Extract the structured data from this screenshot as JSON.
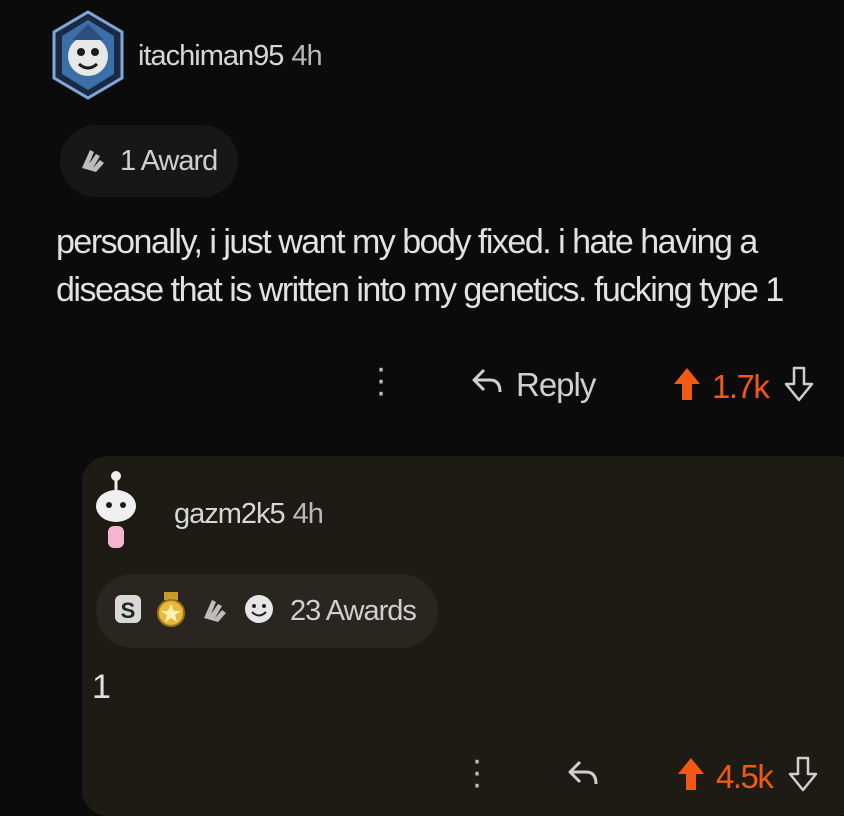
{
  "comment": {
    "username": "itachiman95",
    "time": "4h",
    "award_label": "1 Award",
    "body_line1": "personally, i just want my body fixed. i hate having a",
    "body_line2": "disease that is written into my genetics. fucking type 1",
    "reply_label": "Reply",
    "score": "1.7k",
    "icons": {
      "avatar": "avatar-icon",
      "award": "hands-award-icon",
      "menu": "more-options-icon",
      "reply": "reply-arrow-icon",
      "upvote": "upvote-arrow-icon",
      "downvote": "downvote-arrow-icon"
    }
  },
  "reply": {
    "username": "gazm2k5",
    "time": "4h",
    "award_label": "23 Awards",
    "body": "1",
    "score": "4.5k",
    "icons": {
      "avatar": "snoo-avatar-icon",
      "awards": [
        "silver-award-icon",
        "gold-award-icon",
        "hands-award-icon",
        "wholesome-award-icon"
      ],
      "menu": "more-options-icon",
      "reply": "reply-arrow-icon",
      "upvote": "upvote-arrow-icon",
      "downvote": "downvote-arrow-icon"
    }
  },
  "colors": {
    "background": "#0b0b0c",
    "reply_card": "#1e1a14",
    "upvote": "#f05a14",
    "text": "#e2e2e2"
  }
}
